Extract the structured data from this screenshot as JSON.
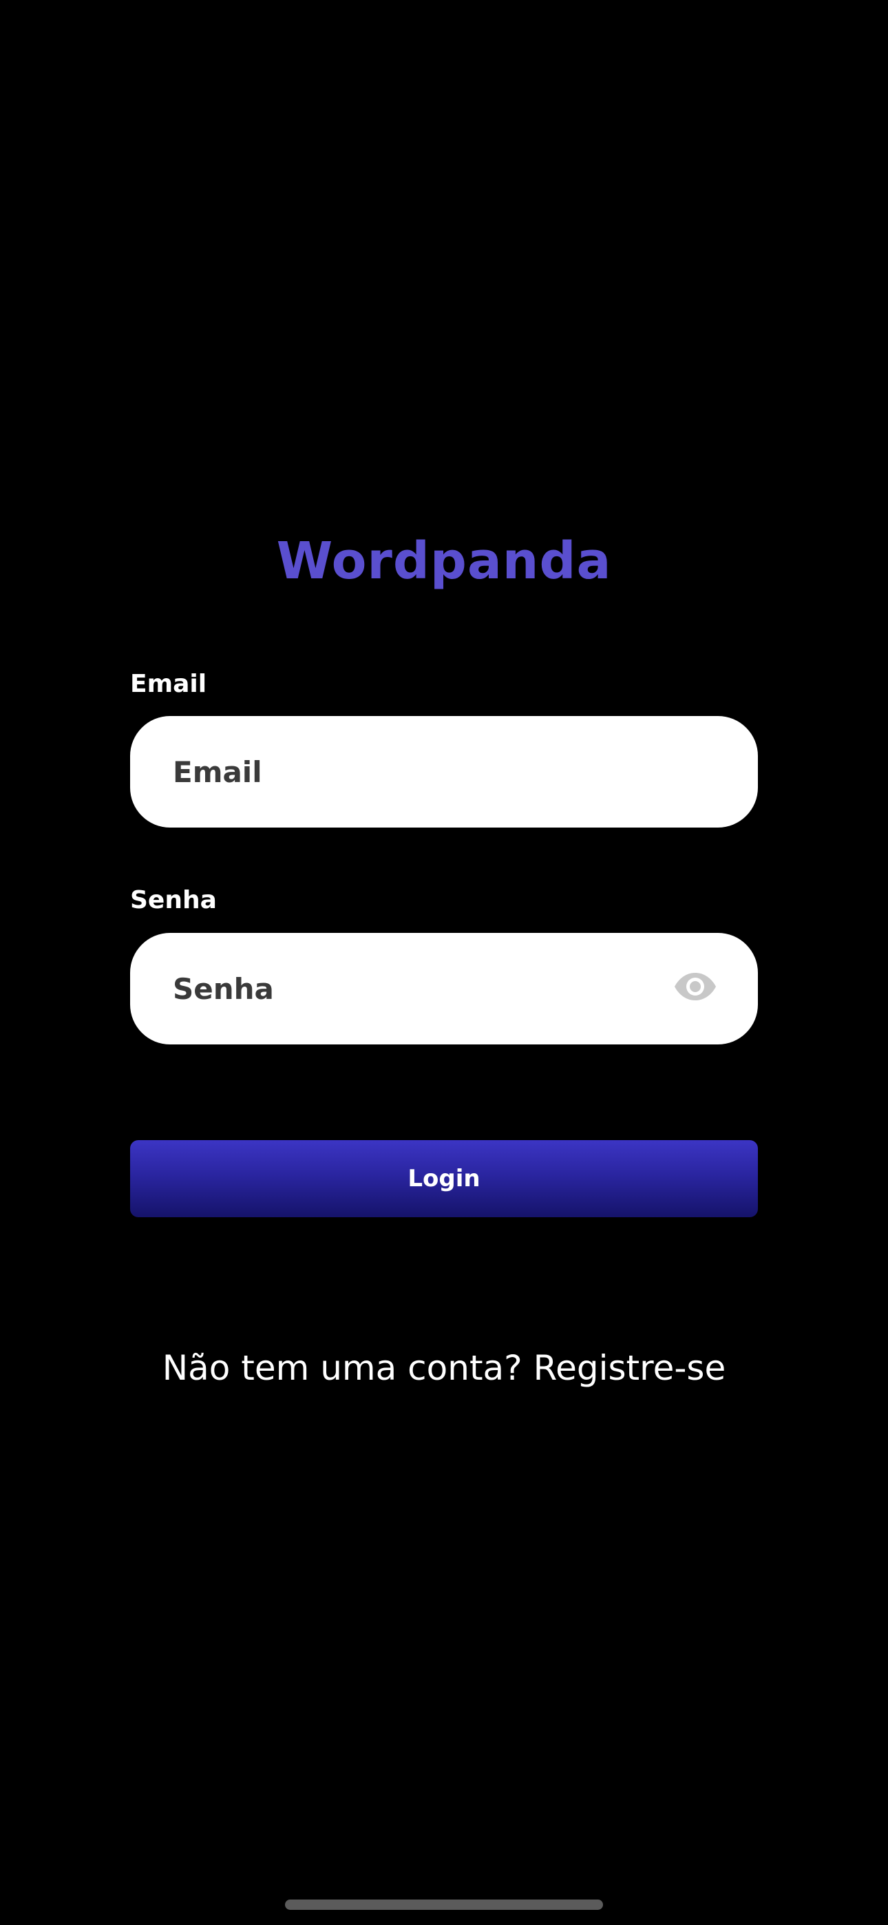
{
  "app": {
    "title": "Wordpanda",
    "title_color": "#5a4fcf"
  },
  "form": {
    "email": {
      "label": "Email",
      "value": "",
      "placeholder": "Email"
    },
    "password": {
      "label": "Senha",
      "value": "",
      "placeholder": "Senha",
      "toggle_icon": "eye-icon"
    },
    "login_button": {
      "label": "Login",
      "gradient_top": "#3c35c4",
      "gradient_bottom": "#15136a"
    }
  },
  "footer": {
    "register_prompt": "Não tem uma conta? Registre-se"
  },
  "colors": {
    "background": "#000000",
    "input_background": "#ffffff",
    "home_indicator": "#5b5b5b"
  }
}
